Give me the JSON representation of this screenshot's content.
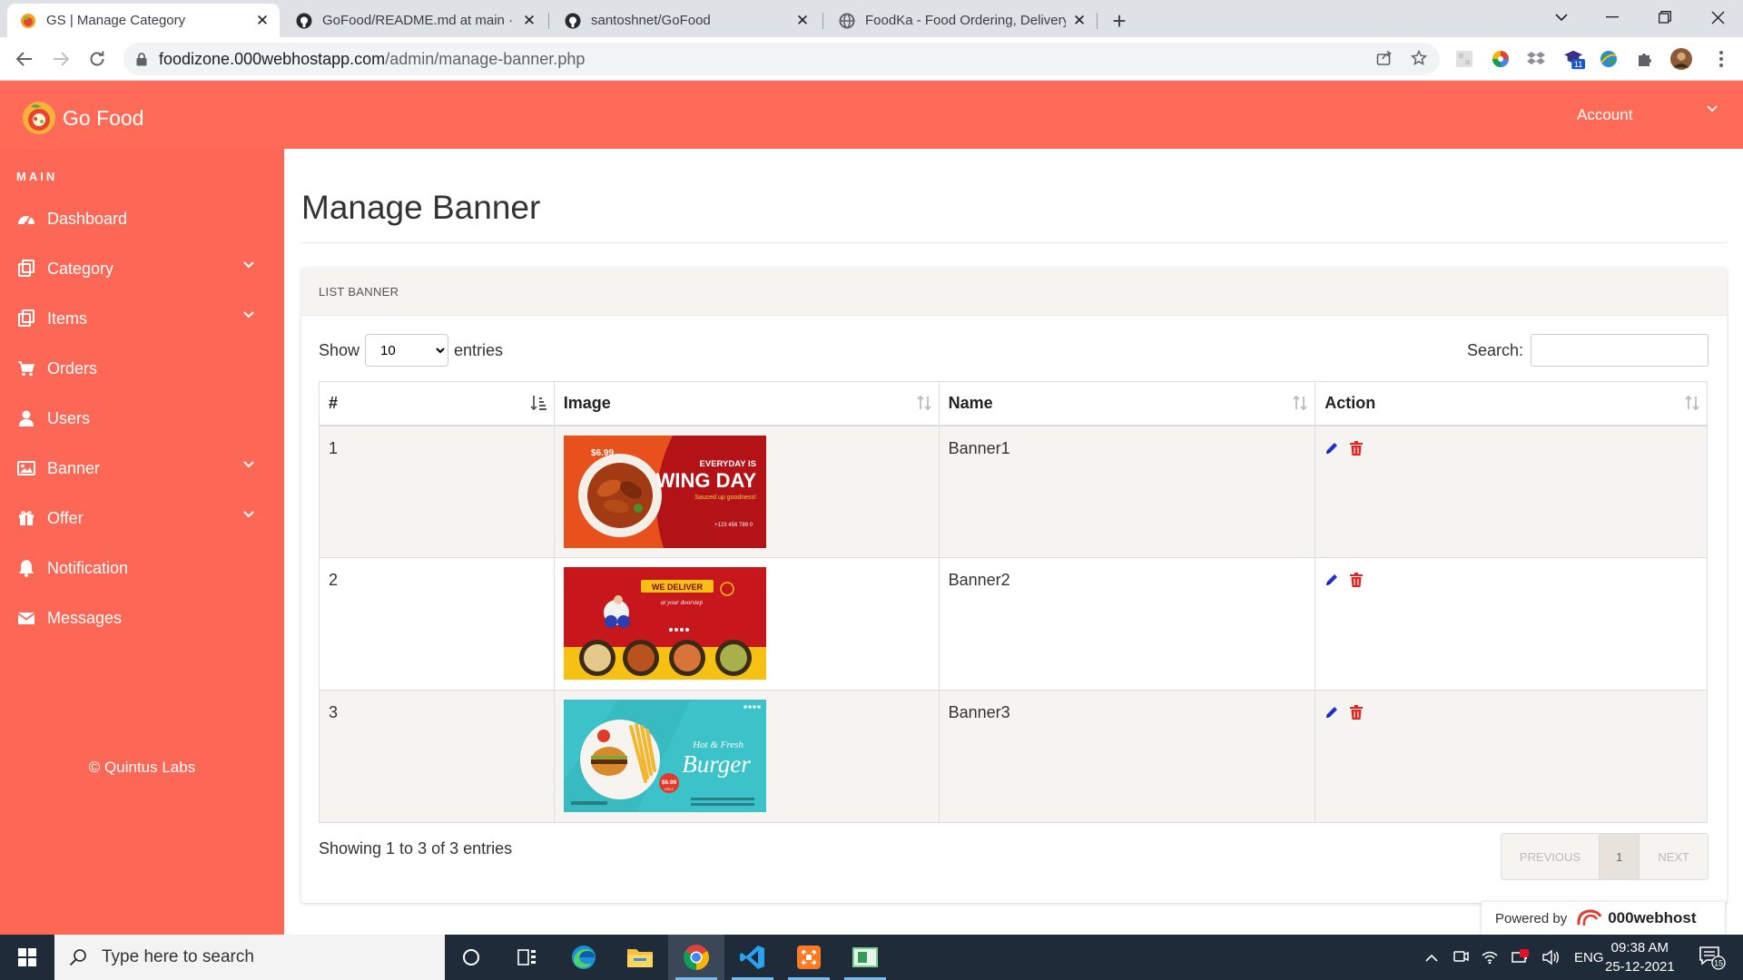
{
  "browser": {
    "tabs": [
      {
        "title": "GS | Manage Category",
        "icon": "gofood-favicon",
        "active": true
      },
      {
        "title": "GoFood/README.md at main · sa",
        "icon": "github-icon",
        "active": false
      },
      {
        "title": "santoshnet/GoFood",
        "icon": "github-icon",
        "active": false
      },
      {
        "title": "FoodKa - Food Ordering, Delivery",
        "icon": "globe-icon",
        "active": false
      }
    ],
    "url_host": "foodizone.000webhostapp.com",
    "url_path": "/admin/manage-banner.php",
    "extension_badge": "11"
  },
  "app": {
    "brand": "Go Food",
    "account_label": "Account",
    "colors": {
      "primary": "#ff6b57",
      "sidebar": "#fd6756"
    }
  },
  "sidebar": {
    "section": "MAIN",
    "items": [
      {
        "label": "Dashboard",
        "icon": "dashboard-icon",
        "has_submenu": false
      },
      {
        "label": "Category",
        "icon": "category-icon",
        "has_submenu": true
      },
      {
        "label": "Items",
        "icon": "items-icon",
        "has_submenu": true
      },
      {
        "label": "Orders",
        "icon": "cart-icon",
        "has_submenu": false
      },
      {
        "label": "Users",
        "icon": "user-icon",
        "has_submenu": false
      },
      {
        "label": "Banner",
        "icon": "image-icon",
        "has_submenu": true
      },
      {
        "label": "Offer",
        "icon": "gift-icon",
        "has_submenu": true
      },
      {
        "label": "Notification",
        "icon": "bell-icon",
        "has_submenu": false
      },
      {
        "label": "Messages",
        "icon": "envelope-icon",
        "has_submenu": false
      }
    ],
    "footer": "© Quintus Labs"
  },
  "page": {
    "title": "Manage Banner",
    "card_title": "LIST BANNER",
    "show_label": "Show",
    "entries_value": "10",
    "entries_label": "entries",
    "search_label": "Search:",
    "columns": [
      "#",
      "Image",
      "Name",
      "Action"
    ],
    "rows": [
      {
        "num": "1",
        "name": "Banner1",
        "banner": {
          "price": "$6.99",
          "line1": "EVERYDAY IS",
          "line2": "WING DAY",
          "line3": "Sauced up goodness!",
          "phone": "+123 456 789 0"
        }
      },
      {
        "num": "2",
        "name": "Banner2",
        "banner": {
          "line1": "WE DELIVER",
          "line2": "at your doorstep"
        }
      },
      {
        "num": "3",
        "name": "Banner3",
        "banner": {
          "line1": "Hot & Fresh",
          "line2": "Burger",
          "price": "$6.99",
          "price_note": "ONLY"
        }
      }
    ],
    "info": "Showing 1 to 3 of 3 entries",
    "pagination": {
      "previous": "PREVIOUS",
      "current": "1",
      "next": "NEXT"
    }
  },
  "powered": {
    "label": "Powered by",
    "brand": "000webhost"
  },
  "taskbar": {
    "search_placeholder": "Type here to search",
    "language": "ENG",
    "time": "09:38 AM",
    "date": "25-12-2021",
    "notification_count": "15"
  }
}
